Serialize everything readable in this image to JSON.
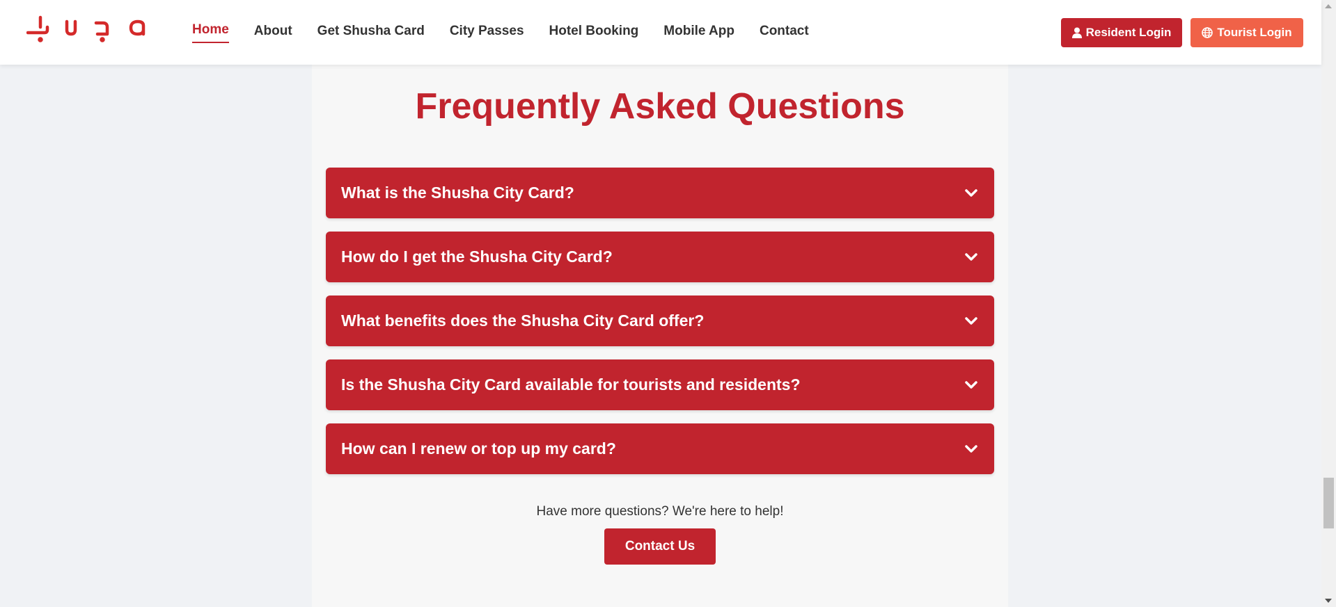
{
  "header": {
    "logo_text": "Şuşa",
    "nav": [
      {
        "label": "Home",
        "active": true
      },
      {
        "label": "About",
        "active": false
      },
      {
        "label": "Get Shusha Card",
        "active": false
      },
      {
        "label": "City Passes",
        "active": false
      },
      {
        "label": "Hotel Booking",
        "active": false
      },
      {
        "label": "Mobile App",
        "active": false
      },
      {
        "label": "Contact",
        "active": false
      }
    ],
    "resident_login": "Resident Login",
    "tourist_login": "Tourist Login",
    "resident_icon": "user-icon",
    "tourist_icon": "globe-icon"
  },
  "faq": {
    "title": "Frequently Asked Questions",
    "items": [
      {
        "question": "What is the Shusha City Card?"
      },
      {
        "question": "How do I get the Shusha City Card?"
      },
      {
        "question": "What benefits does the Shusha City Card offer?"
      },
      {
        "question": "Is the Shusha City Card available for tourists and residents?"
      },
      {
        "question": "How can I renew or top up my card?"
      }
    ],
    "chevron_icon": "chevron-down-icon",
    "help_text": "Have more questions? We're here to help!",
    "contact_button": "Contact Us"
  },
  "colors": {
    "brand_red": "#c1242e",
    "accent_orange": "#f06248",
    "panel_bg": "#f7f7f7",
    "page_bg": "#f0f2f5"
  }
}
